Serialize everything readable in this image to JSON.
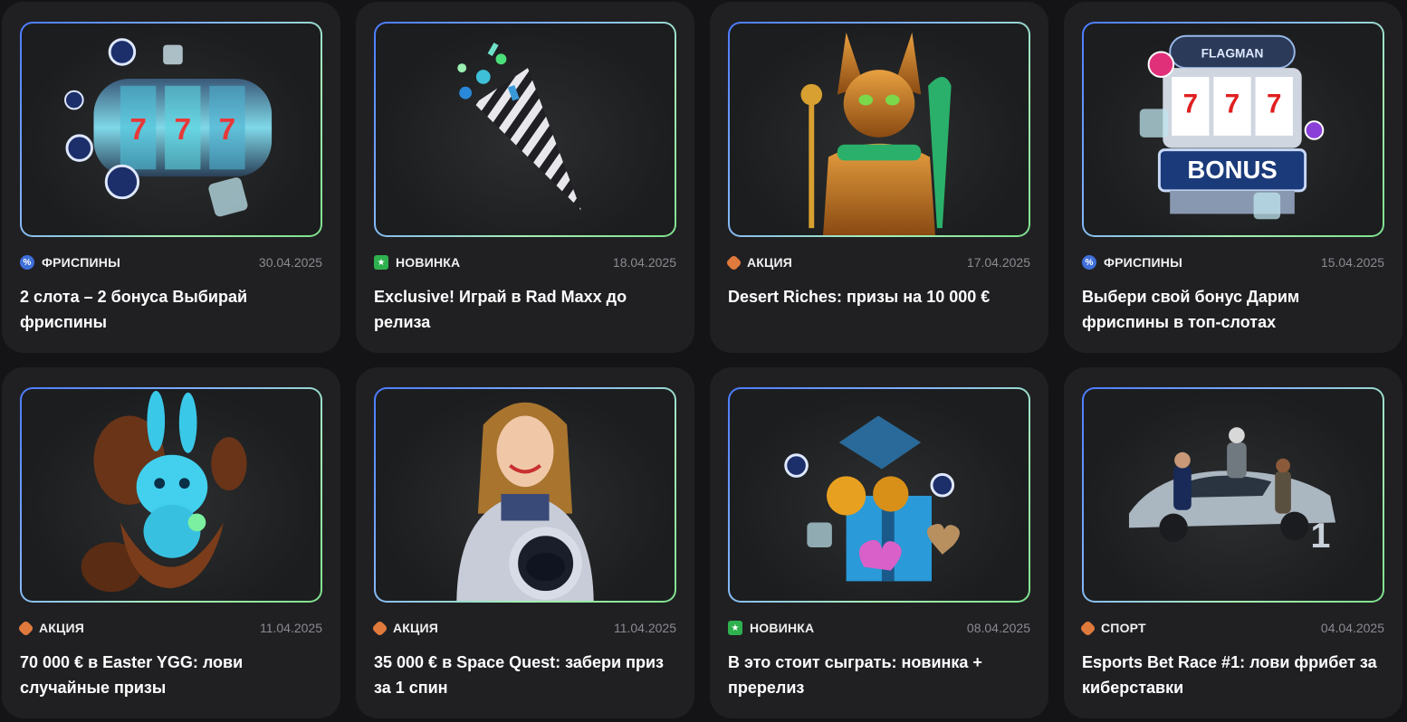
{
  "cards": [
    {
      "tag": "ФРИСПИНЫ",
      "tag_color": "#3f6fd8",
      "tag_icon": "ticket-icon",
      "date": "30.04.2025",
      "title": "2 слота – 2 бонуса Выбирай фриспины",
      "image": "slot-reels-image"
    },
    {
      "tag": "НОВИНКА",
      "tag_color": "#2fb04e",
      "tag_icon": "star-icon",
      "date": "18.04.2025",
      "title": "Exclusive! Играй в Rad Maxx до релиза",
      "image": "party-popper-image"
    },
    {
      "tag": "АКЦИЯ",
      "tag_color": "#e07a3c",
      "tag_icon": "gift-icon",
      "date": "17.04.2025",
      "title": "Desert Riches: призы на 10 000 €",
      "image": "golden-cat-image"
    },
    {
      "tag": "ФРИСПИНЫ",
      "tag_color": "#3f6fd8",
      "tag_icon": "ticket-icon",
      "date": "15.04.2025",
      "title": "Выбери свой бонус Дарим фриспины в топ-слотах",
      "image": "bonus-slot-machine-image"
    },
    {
      "tag": "АКЦИЯ",
      "tag_color": "#e07a3c",
      "tag_icon": "gift-icon",
      "date": "11.04.2025",
      "title": "70 000 € в Easter YGG: лови случайные призы",
      "image": "easter-bunny-image"
    },
    {
      "tag": "АКЦИЯ",
      "tag_color": "#e07a3c",
      "tag_icon": "gift-icon",
      "date": "11.04.2025",
      "title": "35 000 € в Space Quest: забери приз за 1 спин",
      "image": "astronaut-girl-image"
    },
    {
      "tag": "НОВИНКА",
      "tag_color": "#2fb04e",
      "tag_icon": "star-icon",
      "date": "08.04.2025",
      "title": "В это стоит сыграть: новинка + пререлиз",
      "image": "gift-box-image"
    },
    {
      "tag": "СПОРТ",
      "tag_color": "#e07a3c",
      "tag_icon": "gift-icon",
      "date": "04.04.2025",
      "title": "Esports Bet Race #1: лови фрибет за киберставки",
      "image": "esports-car-image"
    }
  ],
  "images": {
    "bonus_sign": "BONUS",
    "brand": "FLAGMAN"
  }
}
